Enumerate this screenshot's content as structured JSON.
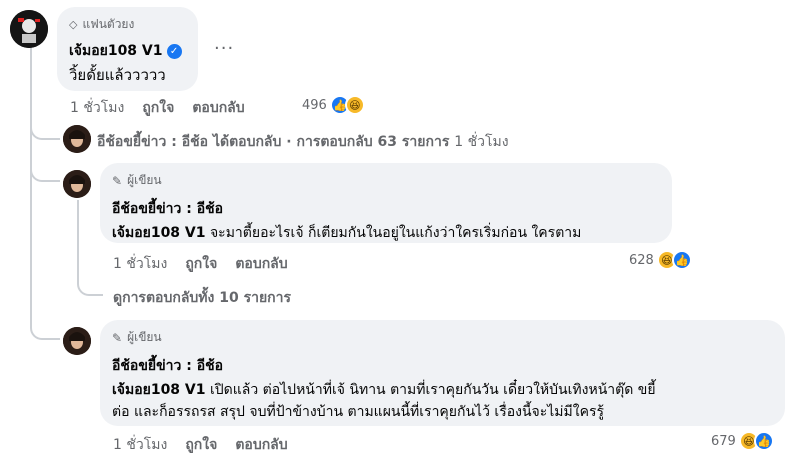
{
  "comment1": {
    "badge": "แฟนตัวยง",
    "badge_icon": "diamond-icon",
    "author": "เจ้มอย108 V1",
    "text": "วิ้ยดั้ยแล้ววววว",
    "more": "···",
    "time": "1 ชั่วโมง",
    "like_label": "ถูกใจ",
    "reply_label": "ตอบกลับ",
    "reaction_count": "496"
  },
  "reply_summary": {
    "author": "อีช้อขยี้ข่าว : อีช้อ",
    "replied": "ได้ตอบกลับ",
    "sep": "·",
    "count_text": "การตอบกลับ 63 รายการ",
    "time": "1 ชั่วโมง"
  },
  "reply1": {
    "badge": "ผู้เขียน",
    "badge_icon": "pencil-icon",
    "author": "อีช้อขยี้ข่าว : อีช้อ",
    "mention": "เจ้มอย108 V1",
    "text": " จะมาตี้ยอะไรเจ้ ก็เตียมกันในอยู่ในแก้งว่าใครเริ่มก่อน ใครตาม",
    "time": "1 ชั่วโมง",
    "like_label": "ถูกใจ",
    "reply_label": "ตอบกลับ",
    "reaction_count": "628"
  },
  "view_more": "ดูการตอบกลับทั้ง 10 รายการ",
  "reply2": {
    "badge": "ผู้เขียน",
    "badge_icon": "pencil-icon",
    "author": "อีช้อขยี้ข่าว : อีช้อ",
    "mention": "เจ้มอย108 V1",
    "text_line1": " เปิดแล้ว ต่อไปหน้าที่เจ้ นิทาน ตามที่เราคุยกันวัน เดี๋ยวให้บันเทิงหน้าตุ๊ด ขยี้",
    "text_line2": "ต่อ และก็อรรถรส สรุป จบที่ป้าข้างบ้าน ตามแผนนี้ที่เราคุยกันไว้ เรื่องนี้จะไม่มีใครรู้",
    "time": "1 ชั่วโมง",
    "like_label": "ถูกใจ",
    "reply_label": "ตอบกลับ",
    "reaction_count": "679"
  },
  "colors": {
    "like": "#1877f2",
    "haha": "#f7b928",
    "bubble": "#f0f2f5",
    "muted": "#65676b"
  }
}
